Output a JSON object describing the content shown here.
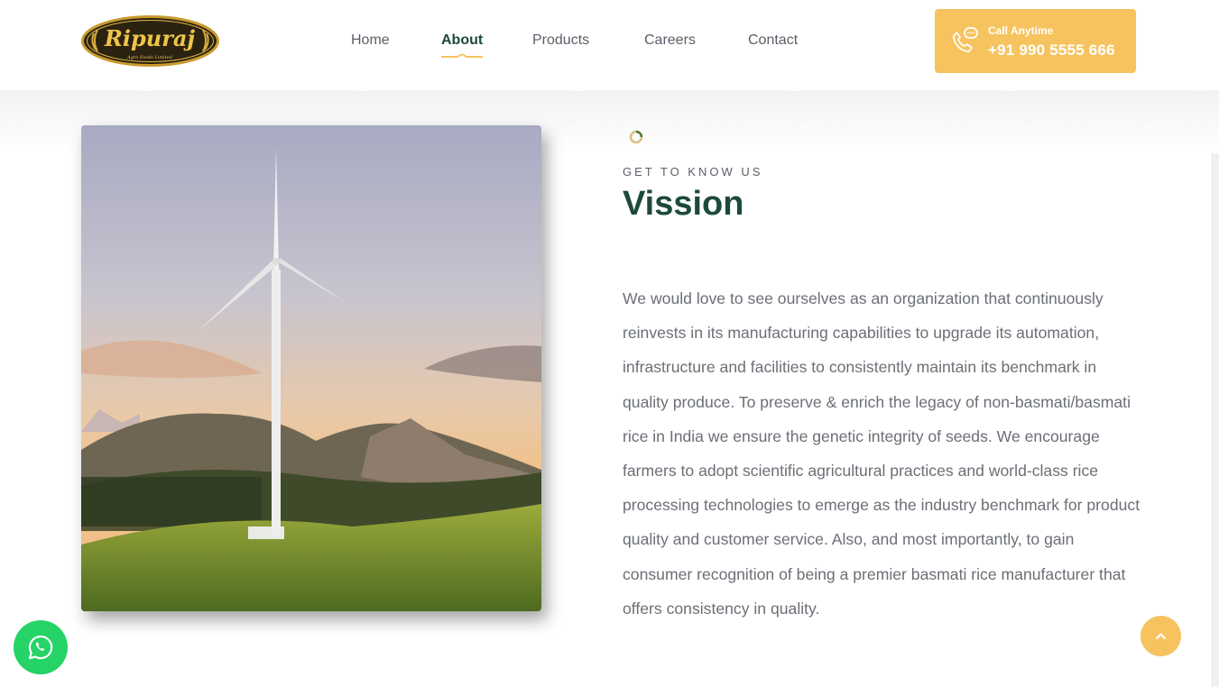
{
  "brand": {
    "logo_text": "Ripuraj",
    "logo_tagline": "Agro Foods Limited"
  },
  "nav": {
    "items": [
      {
        "label": "Home",
        "active": false
      },
      {
        "label": "About",
        "active": true
      },
      {
        "label": "Products",
        "active": false
      },
      {
        "label": "Careers",
        "active": false
      },
      {
        "label": "Contact",
        "active": false
      }
    ]
  },
  "call": {
    "label": "Call Anytime",
    "phone": "+91 990 5555 666"
  },
  "section": {
    "eyebrow": "GET TO KNOW US",
    "title": "Vission",
    "body": "We would love to see ourselves as an organization that continuously reinvests in its manufacturing capabilities to upgrade its automation, infrastructure and facilities to consistently maintain its benchmark in quality produce. To preserve & enrich the legacy of non-basmati/basmati rice in India we ensure the genetic integrity of seeds. We encourage farmers to adopt scientific agricultural practices and world-class rice processing technologies to emerge as the industry benchmark for product quality and customer service. Also, and most importantly, to gain consumer recognition of being a premier basmati rice manufacturer that offers consistency in quality."
  },
  "colors": {
    "accent": "#f6c35f",
    "heading": "#1d4a3c",
    "body_text": "#6b6f76",
    "whatsapp": "#25d366"
  },
  "icons": [
    "phone-chat-icon",
    "loading-spinner-icon",
    "whatsapp-icon",
    "chevron-up-icon"
  ]
}
